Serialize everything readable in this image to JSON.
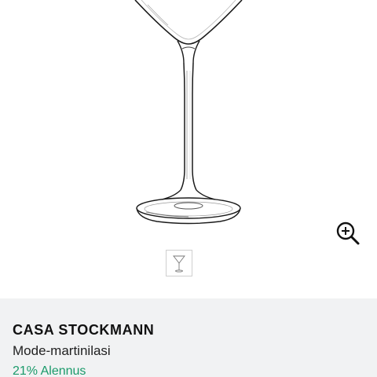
{
  "product": {
    "brand": "CASA STOCKMANN",
    "name": "Mode-martinilasi",
    "discount": "21% Alennus"
  },
  "gallery": {
    "image_icon": "martini-glass-image",
    "zoom_icon": "zoom-in-icon",
    "thumbnail_icon": "martini-glass-thumbnail"
  },
  "colors": {
    "background": "#ffffff",
    "info_background": "#f1f2f3",
    "brand_text": "#111111",
    "discount_text": "#1a9a6a",
    "thumb_border": "#cfcfcf"
  }
}
